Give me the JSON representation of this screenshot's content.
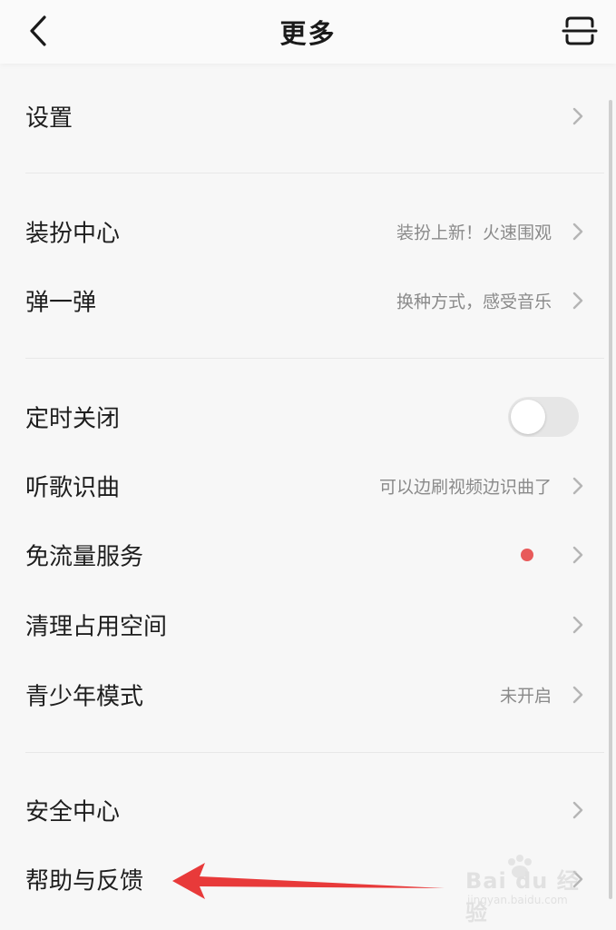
{
  "header": {
    "title": "更多",
    "back_icon": "chevron-left-icon",
    "scan_icon": "scan-icon"
  },
  "rows": {
    "settings": {
      "label": "设置"
    },
    "dressup": {
      "label": "装扮中心",
      "sub": "装扮上新！火速围观"
    },
    "bounce": {
      "label": "弹一弹",
      "sub": "换种方式，感受音乐"
    },
    "timer": {
      "label": "定时关闭",
      "toggle_on": false
    },
    "recognize": {
      "label": "听歌识曲",
      "sub": "可以边刷视频边识曲了"
    },
    "free_data": {
      "label": "免流量服务",
      "has_badge": true
    },
    "cleanup": {
      "label": "清理占用空间"
    },
    "teen": {
      "label": "青少年模式",
      "sub": "未开启"
    },
    "security": {
      "label": "安全中心"
    },
    "help": {
      "label": "帮助与反馈"
    }
  },
  "colors": {
    "background": "#f7f7f7",
    "badge_red": "#e85a5a",
    "annotation_arrow": "#e83a3a",
    "subtext": "#8a8a8a"
  },
  "watermark": {
    "text": "Bai du 经验",
    "url": "jingyan.baidu.com"
  }
}
